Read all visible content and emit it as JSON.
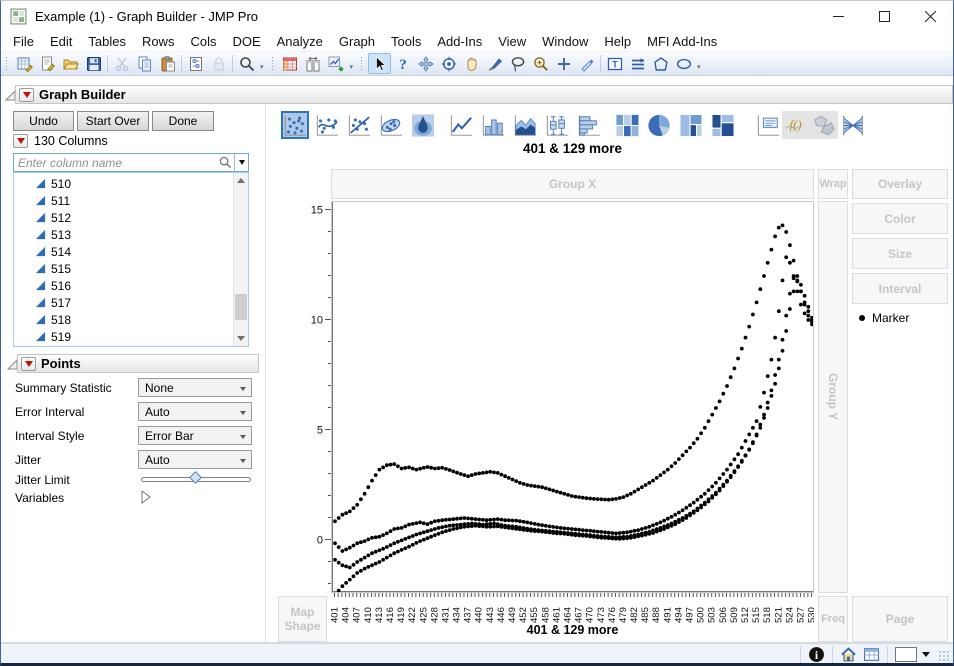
{
  "window": {
    "title": "Example (1) - Graph Builder - JMP Pro",
    "controls": [
      "minimize",
      "maximize",
      "close"
    ]
  },
  "menubar": {
    "items": [
      "File",
      "Edit",
      "Tables",
      "Rows",
      "Cols",
      "DOE",
      "Analyze",
      "Graph",
      "Tools",
      "Add-Ins",
      "View",
      "Window",
      "Help",
      "MFI Add-Ins"
    ]
  },
  "toolbar": {
    "groups": [
      {
        "items": [
          {
            "icon": "new-journal"
          },
          {
            "icon": "new-script"
          },
          {
            "icon": "open"
          },
          {
            "icon": "save"
          },
          {
            "sep": true
          },
          {
            "icon": "cut",
            "disabled": true
          },
          {
            "icon": "copy"
          },
          {
            "icon": "paste"
          },
          {
            "sep": true
          },
          {
            "icon": "preferences"
          },
          {
            "icon": "lock",
            "disabled": true
          },
          {
            "sep": true
          },
          {
            "icon": "search"
          }
        ]
      },
      {
        "items": [
          {
            "icon": "data-table"
          },
          {
            "icon": "columns-icon"
          },
          {
            "icon": "new-graph"
          }
        ]
      },
      {
        "items": [
          {
            "icon": "pointer",
            "selected": true
          },
          {
            "icon": "help"
          },
          {
            "icon": "move-tool"
          },
          {
            "icon": "target"
          },
          {
            "icon": "hand"
          },
          {
            "icon": "brush"
          },
          {
            "icon": "lasso"
          },
          {
            "icon": "zoom-in"
          },
          {
            "icon": "crosshair"
          },
          {
            "icon": "annotate"
          },
          {
            "sep": true
          },
          {
            "icon": "textbox"
          },
          {
            "icon": "lines-tool"
          },
          {
            "icon": "polygon-tool"
          },
          {
            "icon": "oval-tool"
          }
        ]
      }
    ]
  },
  "graph_builder": {
    "title": "Graph Builder",
    "buttons": {
      "undo": "Undo",
      "start_over": "Start Over",
      "done": "Done"
    }
  },
  "columns_panel": {
    "header": "130 Columns",
    "search_placeholder": "Enter column name",
    "items": [
      "510",
      "511",
      "512",
      "513",
      "514",
      "515",
      "516",
      "517",
      "518",
      "519"
    ]
  },
  "points_panel": {
    "title": "Points",
    "controls": [
      {
        "label": "Summary Statistic",
        "value": "None"
      },
      {
        "label": "Error Interval",
        "value": "Auto"
      },
      {
        "label": "Interval Style",
        "value": "Error Bar"
      },
      {
        "label": "Jitter",
        "value": "Auto"
      }
    ],
    "jitter_limit_label": "Jitter Limit",
    "variables_label": "Variables"
  },
  "palette": {
    "items": [
      {
        "icon": "points",
        "selected": true
      },
      {
        "icon": "smoother"
      },
      {
        "icon": "line-of-fit"
      },
      {
        "icon": "ellipse"
      },
      {
        "icon": "contour"
      },
      {
        "icon": "line-chart"
      },
      {
        "icon": "bar-chart"
      },
      {
        "icon": "area-chart"
      },
      {
        "icon": "box-plot"
      },
      {
        "icon": "histogram"
      },
      {
        "icon": "heatmap"
      },
      {
        "icon": "pie-chart"
      },
      {
        "icon": "treemap"
      },
      {
        "icon": "mosaic"
      },
      {
        "icon": "caption-box"
      },
      {
        "icon": "formula",
        "gray": true
      },
      {
        "icon": "map-shapes",
        "gray": true
      },
      {
        "icon": "parallel-plot"
      }
    ]
  },
  "graph": {
    "title": "401 & 129 more",
    "zones": {
      "group_x": "Group X",
      "wrap": "Wrap",
      "overlay": "Overlay",
      "color": "Color",
      "size": "Size",
      "interval": "Interval",
      "group_y": "Group Y",
      "map_shape": "Map Shape",
      "freq": "Freq",
      "page": "Page"
    },
    "legend_marker": "Marker",
    "x_axis_label": "401 & 129 more"
  },
  "statusbar": {
    "icons": [
      "info",
      "home",
      "status-table",
      "view-box",
      "dropdown-arrow",
      "resize-grip"
    ]
  },
  "chart_data": {
    "type": "scatter",
    "title": "401 & 129 more",
    "xlabel": "401 & 129 more",
    "ylabel": "",
    "grid": false,
    "legend": [
      "Marker"
    ],
    "marker_color": "#000000",
    "xlim": [
      399.5,
      531.5
    ],
    "ylim": [
      -2.45,
      15.35
    ],
    "y_major_ticks": [
      0,
      5,
      10,
      15
    ],
    "x_tick_minor_step": 1,
    "x_tick_labels": [
      401,
      404,
      407,
      410,
      413,
      416,
      419,
      422,
      425,
      428,
      431,
      434,
      437,
      440,
      443,
      446,
      449,
      452,
      455,
      458,
      461,
      464,
      467,
      470,
      473,
      476,
      479,
      482,
      485,
      488,
      491,
      494,
      497,
      500,
      503,
      506,
      509,
      512,
      515,
      518,
      521,
      524,
      527,
      530
    ],
    "series": [
      {
        "name": "series-1",
        "points": [
          [
            401,
            0.85
          ],
          [
            403,
            1.15
          ],
          [
            405,
            1.3
          ],
          [
            407,
            1.6
          ],
          [
            409,
            2.1
          ],
          [
            411,
            2.7
          ],
          [
            413,
            3.2
          ],
          [
            415,
            3.4
          ],
          [
            417,
            3.45
          ],
          [
            419,
            3.25
          ],
          [
            421,
            3.3
          ],
          [
            423,
            3.2
          ],
          [
            426,
            3.32
          ],
          [
            428,
            3.25
          ],
          [
            430,
            3.28
          ],
          [
            432,
            3.18
          ],
          [
            435,
            3.0
          ],
          [
            437,
            2.9
          ],
          [
            439,
            3.0
          ],
          [
            441,
            3.05
          ],
          [
            443,
            3.1
          ],
          [
            445,
            3.05
          ],
          [
            447,
            2.9
          ],
          [
            449,
            2.75
          ],
          [
            451,
            2.6
          ],
          [
            453,
            2.5
          ],
          [
            455,
            2.45
          ],
          [
            457,
            2.4
          ],
          [
            459,
            2.3
          ],
          [
            461,
            2.2
          ],
          [
            463,
            2.1
          ],
          [
            465,
            2.0
          ],
          [
            467,
            1.95
          ],
          [
            469,
            1.9
          ],
          [
            471,
            1.87
          ],
          [
            473,
            1.85
          ],
          [
            475,
            1.83
          ],
          [
            477,
            1.87
          ],
          [
            479,
            1.95
          ],
          [
            481,
            2.1
          ],
          [
            483,
            2.3
          ],
          [
            485,
            2.5
          ],
          [
            487,
            2.7
          ],
          [
            489,
            2.95
          ],
          [
            491,
            3.2
          ],
          [
            493,
            3.5
          ],
          [
            495,
            3.85
          ],
          [
            497,
            4.2
          ],
          [
            499,
            4.6
          ],
          [
            501,
            5.1
          ],
          [
            503,
            5.7
          ],
          [
            505,
            6.3
          ],
          [
            507,
            7.0
          ],
          [
            509,
            7.8
          ],
          [
            511,
            8.7
          ],
          [
            513,
            9.7
          ],
          [
            515,
            10.8
          ],
          [
            517,
            12.0
          ],
          [
            519,
            13.2
          ],
          [
            520,
            13.8
          ],
          [
            521,
            14.2
          ],
          [
            522,
            14.3
          ],
          [
            523,
            14.0
          ],
          [
            524,
            13.4
          ],
          [
            525,
            12.7
          ],
          [
            526,
            12.0
          ],
          [
            527,
            11.3
          ],
          [
            528,
            10.7
          ],
          [
            529,
            10.2
          ],
          [
            530,
            9.8
          ]
        ]
      },
      {
        "name": "series-2",
        "points": [
          [
            401,
            -0.15
          ],
          [
            403,
            -0.5
          ],
          [
            405,
            -0.35
          ],
          [
            407,
            -0.15
          ],
          [
            409,
            -0.05
          ],
          [
            411,
            0.1
          ],
          [
            413,
            0.15
          ],
          [
            415,
            0.3
          ],
          [
            417,
            0.5
          ],
          [
            419,
            0.55
          ],
          [
            421,
            0.7
          ],
          [
            424,
            0.8
          ],
          [
            426,
            0.72
          ],
          [
            428,
            0.85
          ],
          [
            430,
            0.9
          ],
          [
            433,
            0.95
          ],
          [
            436,
            1.0
          ],
          [
            439,
            0.95
          ],
          [
            442,
            0.9
          ],
          [
            445,
            0.95
          ],
          [
            447,
            0.9
          ],
          [
            450,
            0.88
          ],
          [
            453,
            0.8
          ],
          [
            456,
            0.7
          ],
          [
            459,
            0.62
          ],
          [
            462,
            0.55
          ],
          [
            465,
            0.5
          ],
          [
            468,
            0.45
          ],
          [
            471,
            0.4
          ],
          [
            474,
            0.35
          ],
          [
            477,
            0.3
          ],
          [
            480,
            0.35
          ],
          [
            483,
            0.45
          ],
          [
            486,
            0.6
          ],
          [
            489,
            0.8
          ],
          [
            492,
            1.05
          ],
          [
            495,
            1.35
          ],
          [
            498,
            1.7
          ],
          [
            501,
            2.1
          ],
          [
            504,
            2.6
          ],
          [
            507,
            3.2
          ],
          [
            510,
            3.9
          ],
          [
            513,
            4.8
          ],
          [
            515,
            5.4
          ],
          [
            517,
            6.7
          ],
          [
            519,
            8.2
          ],
          [
            520,
            9.2
          ],
          [
            521,
            10.4
          ],
          [
            522,
            11.8
          ],
          [
            523,
            12.85
          ],
          [
            524,
            12.6
          ],
          [
            525,
            12.0
          ],
          [
            526,
            11.3
          ],
          [
            527,
            10.7
          ],
          [
            528,
            10.3
          ],
          [
            529,
            10.0
          ],
          [
            530,
            9.9
          ]
        ]
      },
      {
        "name": "series-3",
        "points": [
          [
            401,
            -0.9
          ],
          [
            403,
            -1.15
          ],
          [
            405,
            -1.25
          ],
          [
            407,
            -1.0
          ],
          [
            409,
            -0.8
          ],
          [
            411,
            -0.6
          ],
          [
            414,
            -0.4
          ],
          [
            417,
            -0.15
          ],
          [
            420,
            0.05
          ],
          [
            423,
            0.25
          ],
          [
            426,
            0.4
          ],
          [
            429,
            0.55
          ],
          [
            432,
            0.65
          ],
          [
            435,
            0.7
          ],
          [
            438,
            0.75
          ],
          [
            441,
            0.7
          ],
          [
            444,
            0.75
          ],
          [
            447,
            0.65
          ],
          [
            450,
            0.6
          ],
          [
            453,
            0.52
          ],
          [
            456,
            0.45
          ],
          [
            459,
            0.4
          ],
          [
            462,
            0.35
          ],
          [
            465,
            0.3
          ],
          [
            468,
            0.25
          ],
          [
            471,
            0.2
          ],
          [
            474,
            0.15
          ],
          [
            477,
            0.12
          ],
          [
            480,
            0.15
          ],
          [
            483,
            0.25
          ],
          [
            486,
            0.38
          ],
          [
            489,
            0.55
          ],
          [
            492,
            0.75
          ],
          [
            495,
            1.0
          ],
          [
            498,
            1.3
          ],
          [
            501,
            1.7
          ],
          [
            504,
            2.15
          ],
          [
            507,
            2.7
          ],
          [
            510,
            3.35
          ],
          [
            513,
            4.1
          ],
          [
            515,
            4.8
          ],
          [
            517,
            5.7
          ],
          [
            519,
            6.8
          ],
          [
            521,
            8.2
          ],
          [
            522,
            9.1
          ],
          [
            523,
            10.2
          ],
          [
            524,
            11.2
          ],
          [
            525,
            11.9
          ],
          [
            526,
            11.75
          ],
          [
            527,
            11.3
          ],
          [
            528,
            10.8
          ],
          [
            529,
            10.4
          ],
          [
            530,
            10.0
          ]
        ]
      },
      {
        "name": "series-4",
        "points": [
          [
            401,
            -2.5
          ],
          [
            403,
            -2.1
          ],
          [
            405,
            -1.8
          ],
          [
            407,
            -1.5
          ],
          [
            409,
            -1.3
          ],
          [
            411,
            -1.15
          ],
          [
            413,
            -1.0
          ],
          [
            415,
            -0.8
          ],
          [
            417,
            -0.6
          ],
          [
            419,
            -0.45
          ],
          [
            421,
            -0.3
          ],
          [
            424,
            -0.05
          ],
          [
            427,
            0.15
          ],
          [
            430,
            0.35
          ],
          [
            433,
            0.5
          ],
          [
            436,
            0.6
          ],
          [
            439,
            0.65
          ],
          [
            442,
            0.6
          ],
          [
            445,
            0.62
          ],
          [
            448,
            0.55
          ],
          [
            451,
            0.48
          ],
          [
            454,
            0.42
          ],
          [
            457,
            0.38
          ],
          [
            460,
            0.32
          ],
          [
            463,
            0.28
          ],
          [
            466,
            0.22
          ],
          [
            469,
            0.18
          ],
          [
            472,
            0.12
          ],
          [
            475,
            0.08
          ],
          [
            478,
            0.05
          ],
          [
            481,
            0.1
          ],
          [
            484,
            0.2
          ],
          [
            487,
            0.32
          ],
          [
            490,
            0.5
          ],
          [
            493,
            0.72
          ],
          [
            496,
            1.0
          ],
          [
            499,
            1.35
          ],
          [
            502,
            1.75
          ],
          [
            505,
            2.25
          ],
          [
            508,
            2.85
          ],
          [
            511,
            3.55
          ],
          [
            514,
            4.4
          ],
          [
            516,
            5.1
          ],
          [
            518,
            6.0
          ],
          [
            520,
            7.1
          ],
          [
            521,
            7.8
          ],
          [
            522,
            8.6
          ],
          [
            523,
            9.5
          ],
          [
            524,
            10.5
          ],
          [
            525,
            11.3
          ],
          [
            526,
            11.8
          ],
          [
            527,
            11.6
          ],
          [
            528,
            11.1
          ],
          [
            529,
            10.6
          ],
          [
            530,
            10.1
          ]
        ]
      }
    ]
  }
}
